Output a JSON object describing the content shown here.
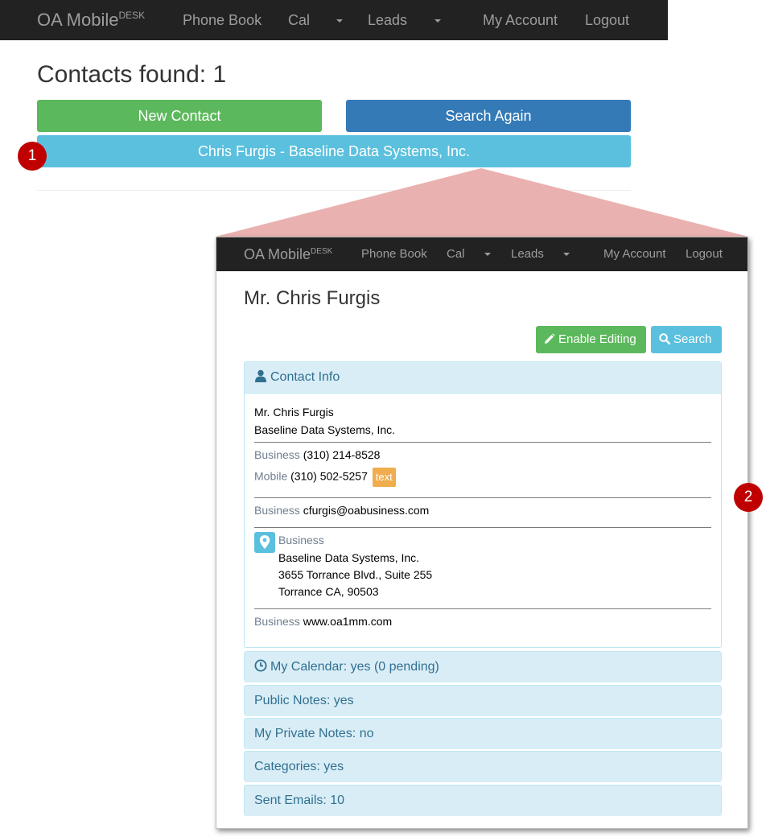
{
  "navbar": {
    "brand": "OA Mobile",
    "brand_sup": "DESK",
    "phone_book": "Phone Book",
    "cal": "Cal",
    "leads": "Leads",
    "my_account": "My Account",
    "logout": "Logout"
  },
  "list": {
    "title": "Contacts found: 1",
    "new_contact": "New Contact",
    "search_again": "Search Again",
    "result": "Chris Furgis - Baseline Data Systems, Inc."
  },
  "callouts": {
    "one": "1",
    "two": "2"
  },
  "detail": {
    "title": "Mr. Chris Furgis",
    "enable_editing": "Enable Editing",
    "search": "Search",
    "contact_info": {
      "header": "Contact Info",
      "name": "Mr. Chris Furgis",
      "company": "Baseline Data Systems, Inc.",
      "business_phone_label": "Business",
      "business_phone": "(310) 214-8528",
      "mobile_label": "Mobile",
      "mobile_phone": "(310) 502-5257",
      "text_badge": "text",
      "email_label": "Business",
      "email": "cfurgis@oabusiness.com",
      "address_label": "Business",
      "address_line1": "Baseline Data Systems, Inc.",
      "address_line2": "3655 Torrance Blvd., Suite 255",
      "address_line3": "Torrance CA, 90503",
      "web_label": "Business",
      "website": "www.oa1mm.com"
    },
    "sections": {
      "calendar": "My Calendar: yes (0 pending)",
      "public_notes": "Public Notes: yes",
      "private_notes": "My Private Notes: no",
      "categories": "Categories: yes",
      "sent_emails": "Sent Emails: 10"
    }
  },
  "colors": {
    "navbar": "#222222",
    "success": "#5cb85c",
    "primary": "#337ab7",
    "info": "#5bc0de",
    "warning": "#f0ad4e",
    "callout": "#c00000",
    "panel_head": "#d9edf7"
  }
}
